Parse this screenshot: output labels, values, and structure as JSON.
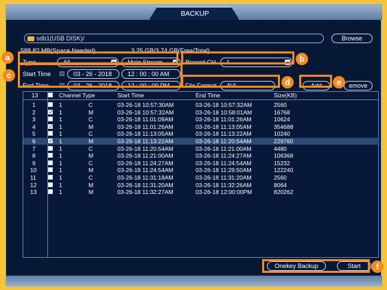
{
  "window": {
    "title": "BACKUP"
  },
  "device": {
    "path": "sdb1(USB DISK)/",
    "space_needed": "588.82 MB(Space Needed)",
    "free_total": "3.25 GB/3.74 GB(Free/Total)",
    "browse_label": "Browse"
  },
  "filters": {
    "type_label": "Type",
    "type_value": "All",
    "stream_value": "Main Stream",
    "record_ch_label": "Record CH",
    "record_ch_value": "1",
    "start_time_label": "Start Time",
    "start_date": "03 - 26 - 2018",
    "start_time": "12 : 00 : 00  AM",
    "end_time_label": "End Time",
    "end_date": "03 - 26 - 2018",
    "end_time": "12 : 00 : 00  PM",
    "file_format_label": "File Format",
    "file_format_value": "AVI",
    "add_label": "Add",
    "remove_label": "emove"
  },
  "badges": {
    "a": "a",
    "b": "b",
    "c": "c",
    "d": "d",
    "e": "e",
    "f": "f"
  },
  "table": {
    "headers": {
      "index": "13",
      "channel_type": "Channel Type",
      "start_time": "Start Time",
      "end_time": "End Time",
      "size": "Size(KB)"
    },
    "rows": [
      {
        "index": "1",
        "checked": false,
        "ch": "1",
        "type": "C",
        "start": "03-26-18 10:57:30AM",
        "end": "03-26-18 10:57:32AM",
        "size": "2560"
      },
      {
        "index": "2",
        "checked": true,
        "ch": "1",
        "type": "M",
        "start": "03-26-18 10:57:32AM",
        "end": "03-26-18 10:58:01AM",
        "size": "16768"
      },
      {
        "index": "3",
        "checked": false,
        "ch": "1",
        "type": "C",
        "start": "03-26-18 11:01:09AM",
        "end": "03-26-18 11:01:26AM",
        "size": "10624"
      },
      {
        "index": "4",
        "checked": true,
        "ch": "1",
        "type": "M",
        "start": "03-26-18 11:01:26AM",
        "end": "03-26-18 11:13:05AM",
        "size": "354688"
      },
      {
        "index": "5",
        "checked": false,
        "ch": "1",
        "type": "C",
        "start": "03-26-18 11:13:05AM",
        "end": "03-26-18 11:13:22AM",
        "size": "10240"
      },
      {
        "index": "6",
        "checked": true,
        "ch": "1",
        "type": "M",
        "start": "03-26-18 11:13:22AM",
        "end": "03-26-18 11:20:54AM",
        "size": "229760"
      },
      {
        "index": "7",
        "checked": false,
        "ch": "1",
        "type": "C",
        "start": "03-26-18 11:20:54AM",
        "end": "03-26-18 11:21:00AM",
        "size": "4480"
      },
      {
        "index": "8",
        "checked": false,
        "ch": "1",
        "type": "M",
        "start": "03-26-18 11:21:00AM",
        "end": "03-26-18 11:24:27AM",
        "size": "106368"
      },
      {
        "index": "9",
        "checked": false,
        "ch": "1",
        "type": "C",
        "start": "03-26-18 11:24:27AM",
        "end": "03-26-18 11:24:54AM",
        "size": "15232"
      },
      {
        "index": "10",
        "checked": false,
        "ch": "1",
        "type": "M",
        "start": "03-26-18 11:24:54AM",
        "end": "03-26-18 11:29:50AM",
        "size": "122240"
      },
      {
        "index": "11",
        "checked": false,
        "ch": "1",
        "type": "C",
        "start": "03-26-18 11:31:18AM",
        "end": "03-26-18 11:31:20AM",
        "size": "2560"
      },
      {
        "index": "12",
        "checked": false,
        "ch": "1",
        "type": "M",
        "start": "03-26-18 11:31:20AM",
        "end": "03-26-18 11:32:26AM",
        "size": "8064"
      },
      {
        "index": "13",
        "checked": false,
        "ch": "1",
        "type": "M",
        "start": "03-26-18 11:32:27AM",
        "end": "03-26-18 12:00:00PM",
        "size": "820262"
      }
    ],
    "selected_index": "6"
  },
  "footer": {
    "onekey_label": "Onekey Backup",
    "start_label": "Start"
  },
  "colors": {
    "accent": "#f58a21",
    "background": "#061834",
    "selected_row": "#2c4a73"
  }
}
